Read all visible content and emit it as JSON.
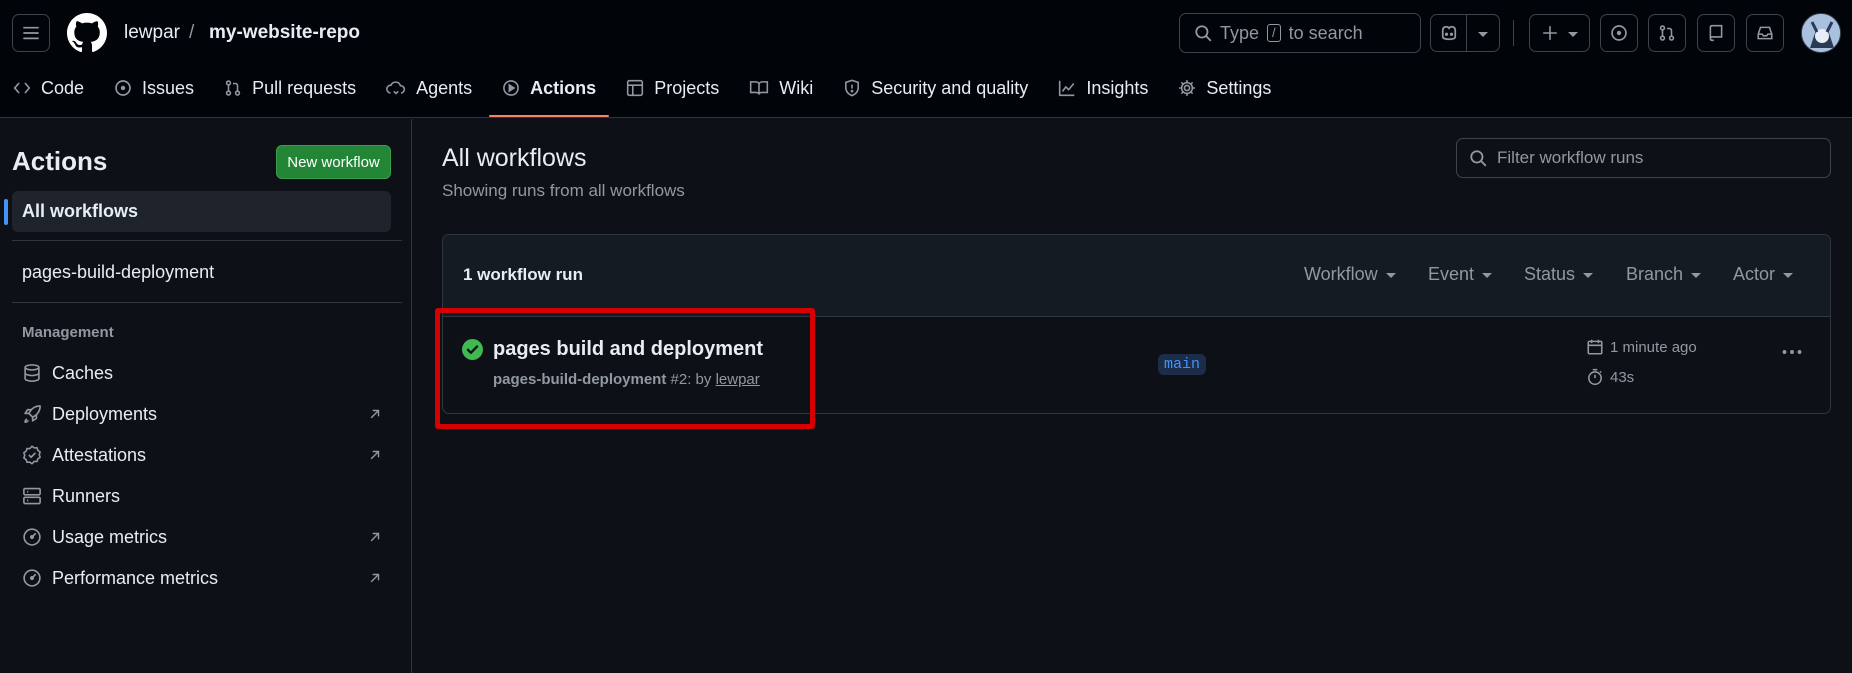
{
  "header": {
    "owner": "lewpar",
    "separator": "/",
    "repo": "my-website-repo",
    "search": {
      "before": "Type",
      "key": "/",
      "after": "to search"
    }
  },
  "tabs": [
    {
      "label": "Code",
      "icon": "code-icon"
    },
    {
      "label": "Issues",
      "icon": "issue-icon"
    },
    {
      "label": "Pull requests",
      "icon": "pull-request-icon"
    },
    {
      "label": "Agents",
      "icon": "agent-icon"
    },
    {
      "label": "Actions",
      "icon": "play-icon",
      "active": true
    },
    {
      "label": "Projects",
      "icon": "table-icon"
    },
    {
      "label": "Wiki",
      "icon": "book-icon"
    },
    {
      "label": "Security and quality",
      "icon": "shield-icon"
    },
    {
      "label": "Insights",
      "icon": "graph-icon"
    },
    {
      "label": "Settings",
      "icon": "gear-icon"
    }
  ],
  "sidebar": {
    "title": "Actions",
    "new_workflow": "New workflow",
    "all_workflows": "All workflows",
    "workflows": [
      "pages-build-deployment"
    ],
    "management_heading": "Management",
    "management": [
      {
        "label": "Caches",
        "icon": "database-icon",
        "external": false
      },
      {
        "label": "Deployments",
        "icon": "rocket-icon",
        "external": true
      },
      {
        "label": "Attestations",
        "icon": "verified-icon",
        "external": true
      },
      {
        "label": "Runners",
        "icon": "server-icon",
        "external": false
      },
      {
        "label": "Usage metrics",
        "icon": "meter-icon",
        "external": true
      },
      {
        "label": "Performance metrics",
        "icon": "meter-icon",
        "external": true
      }
    ]
  },
  "main": {
    "title": "All workflows",
    "subtitle": "Showing runs from all workflows",
    "filter_placeholder": "Filter workflow runs",
    "run_count": "1 workflow run",
    "filters": [
      "Workflow",
      "Event",
      "Status",
      "Branch",
      "Actor"
    ],
    "run": {
      "title": "pages build and deployment",
      "workflow": "pages-build-deployment",
      "number_by": "#2: by",
      "actor": "lewpar",
      "branch": "main",
      "when": "1 minute ago",
      "duration": "43s",
      "status": "success"
    }
  },
  "colors": {
    "accent": "#f78166",
    "success": "#3fb950",
    "highlight": "#d60000",
    "primary_button": "#238636"
  }
}
